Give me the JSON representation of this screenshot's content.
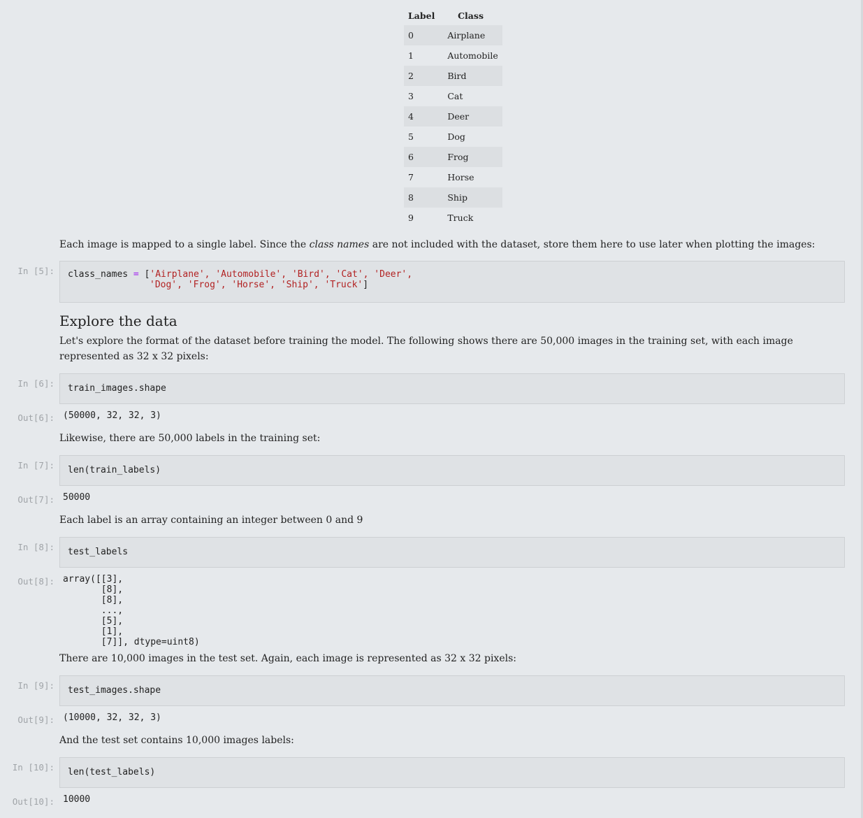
{
  "table": {
    "headers": [
      "Label",
      "Class"
    ],
    "rows": [
      [
        "0",
        "Airplane"
      ],
      [
        "1",
        "Automobile"
      ],
      [
        "2",
        "Bird"
      ],
      [
        "3",
        "Cat"
      ],
      [
        "4",
        "Deer"
      ],
      [
        "5",
        "Dog"
      ],
      [
        "6",
        "Frog"
      ],
      [
        "7",
        "Horse"
      ],
      [
        "8",
        "Ship"
      ],
      [
        "9",
        "Truck"
      ]
    ]
  },
  "para1": {
    "before": "Each image is mapped to a single label. Since the ",
    "em": "class names",
    "after": " are not included with the dataset, store them here to use later when plotting the images:"
  },
  "cell5": {
    "prompt": "In [5]:",
    "var": "class_names ",
    "op": "=",
    "open": " [",
    "line1": "'Airplane', 'Automobile', 'Bird', 'Cat', 'Deer',",
    "line2": "'Dog', 'Frog', 'Horse', 'Ship', 'Truck'",
    "close": "]"
  },
  "heading": "Explore the data",
  "para2": "Let's explore the format of the dataset before training the model. The following shows there are 50,000 images in the training set, with each image represented as 32 x 32 pixels:",
  "cell6": {
    "prompt": "In [6]:",
    "code": "train_images.shape",
    "out_prompt": "Out[6]:",
    "out": "(50000, 32, 32, 3)"
  },
  "para3": "Likewise, there are 50,000 labels in the training set:",
  "cell7": {
    "prompt": "In [7]:",
    "code": "len(train_labels)",
    "out_prompt": "Out[7]:",
    "out": "50000"
  },
  "para4": "Each label is an array containing an integer between 0 and 9",
  "cell8": {
    "prompt": "In [8]:",
    "code": "test_labels",
    "out_prompt": "Out[8]:",
    "out": "array([[3],\n       [8],\n       [8],\n       ...,\n       [5],\n       [1],\n       [7]], dtype=uint8)"
  },
  "para5": "There are 10,000 images in the test set. Again, each image is represented as 32 x 32 pixels:",
  "cell9": {
    "prompt": "In [9]:",
    "code": "test_images.shape",
    "out_prompt": "Out[9]:",
    "out": "(10000, 32, 32, 3)"
  },
  "para6": "And the test set contains 10,000 images labels:",
  "cell10": {
    "prompt": "In [10]:",
    "code": "len(test_labels)",
    "out_prompt": "Out[10]:",
    "out": "10000"
  }
}
